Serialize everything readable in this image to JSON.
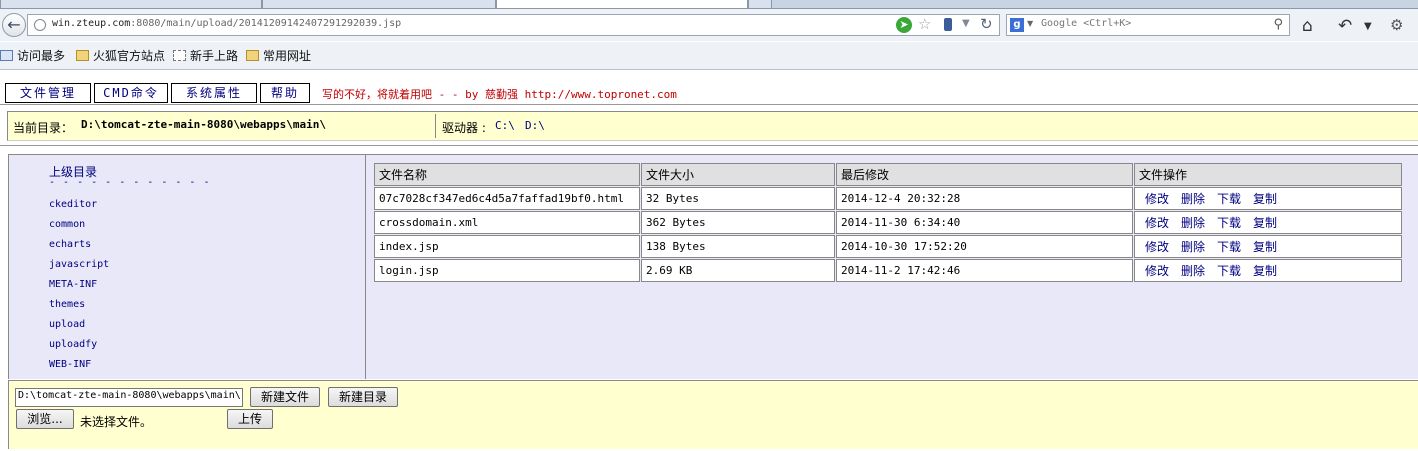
{
  "browser": {
    "url_host": "win.zteup.com",
    "url_rest": ":8080/main/upload/20141209142407291292039.jsp",
    "search_placeholder": "Google <Ctrl+K>",
    "bookmarks": [
      "访问最多",
      "火狐官方站点",
      "新手上路",
      "常用网址"
    ]
  },
  "menu": {
    "items": [
      "文件管理",
      "CMD命令",
      "系统属性",
      "帮助"
    ],
    "slogan": "写的不好，将就着用吧 - - by 慈勤强 http://www.topronet.com"
  },
  "current_dir": {
    "label": "当前目录：",
    "path": "D:\\tomcat-zte-main-8080\\webapps\\main\\",
    "drive_label": "驱动器 :",
    "drives": [
      "C:\\",
      "D:\\"
    ]
  },
  "dir_panel": {
    "parent_label": "上级目录",
    "dashes": "- - - - - - - - - - - -",
    "dirs": [
      "ckeditor",
      "common",
      "echarts",
      "javascript",
      "META-INF",
      "themes",
      "upload",
      "uploadfy",
      "WEB-INF"
    ]
  },
  "file_table": {
    "headers": [
      "文件名称",
      "文件大小",
      "最后修改",
      "文件操作"
    ],
    "rows": [
      {
        "name": "07c7028cf347ed6c4d5a7faffad19bf0.html",
        "size": "32 Bytes",
        "modified": "2014-12-4 20:32:28"
      },
      {
        "name": "crossdomain.xml",
        "size": "362 Bytes",
        "modified": "2014-11-30 6:34:40"
      },
      {
        "name": "index.jsp",
        "size": "138 Bytes",
        "modified": "2014-10-30 17:52:20"
      },
      {
        "name": "login.jsp",
        "size": "2.69 KB",
        "modified": "2014-11-2 17:42:46"
      }
    ],
    "ops": [
      "修改",
      "删除",
      "下载",
      "复制"
    ]
  },
  "upload": {
    "path_value": "D:\\tomcat-zte-main-8080\\webapps\\main\\",
    "new_file_label": "新建文件",
    "new_dir_label": "新建目录",
    "browse_label": "浏览...",
    "no_file_label": "未选择文件。",
    "upload_label": "上传"
  }
}
